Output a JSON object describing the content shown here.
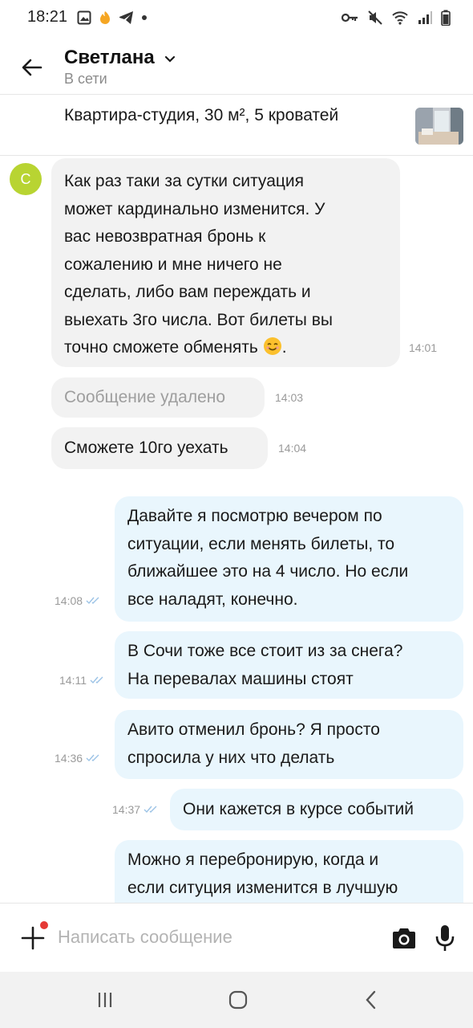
{
  "status_bar": {
    "time": "18:21",
    "left_icons": [
      "gallery-icon",
      "tinder-icon",
      "telegram-icon",
      "dot-icon"
    ],
    "right_icons": [
      "key-icon",
      "mute-icon",
      "wifi-icon",
      "signal-icon",
      "battery-icon"
    ]
  },
  "header": {
    "name": "Светлана",
    "status": "В сети"
  },
  "listing": {
    "title": "Квартира-студия, 30 м², 5 кроватей"
  },
  "chat": {
    "avatar_letter": "С",
    "messages": [
      {
        "id": "m1",
        "direction": "in",
        "lines": [
          "Как раз таки за сутки ситуация",
          "может кардинально изменится. У",
          "вас невозвратная бронь к",
          "сожалению и мне ничего не",
          "сделать, либо вам переждать и",
          "выехать 3го числа. Вот билеты вы",
          "точно сможете обменять"
        ],
        "time": "14:01"
      },
      {
        "id": "m2",
        "direction": "in",
        "deleted": true,
        "text": "Сообщение удалено",
        "time": "14:03"
      },
      {
        "id": "m3",
        "direction": "in",
        "text": "Сможете 10го уехать",
        "time": "14:04"
      },
      {
        "id": "m4",
        "direction": "out",
        "lines": [
          "Давайте я посмотрю вечером по",
          "ситуации, если менять билеты, то",
          "ближайшее это на 4 число. Но если",
          "все наладят, конечно."
        ],
        "time": "14:08"
      },
      {
        "id": "m5",
        "direction": "out",
        "lines": [
          "В Сочи тоже все стоит из за снега?",
          "На перевалах машины стоят"
        ],
        "time": "14:11"
      },
      {
        "id": "m6",
        "direction": "out",
        "lines": [
          "Авито отменил бронь? Я просто",
          "спросила у них что делать"
        ],
        "time": "14:36"
      },
      {
        "id": "m7",
        "direction": "out",
        "text": "Они кажется в курсе событий",
        "time": "14:37"
      },
      {
        "id": "m8",
        "direction": "out",
        "lines": [
          "Можно я перебронирую, когда и",
          "если ситуция изменится в лучшую"
        ]
      }
    ]
  },
  "composer": {
    "placeholder": "Написать сообщение"
  },
  "colors": {
    "incoming_bubble": "#f2f2f2",
    "outgoing_bubble": "#e9f6fd",
    "avatar": "#b8d432",
    "read_checks": "#9cc3e6",
    "notification_dot": "#e53935"
  }
}
